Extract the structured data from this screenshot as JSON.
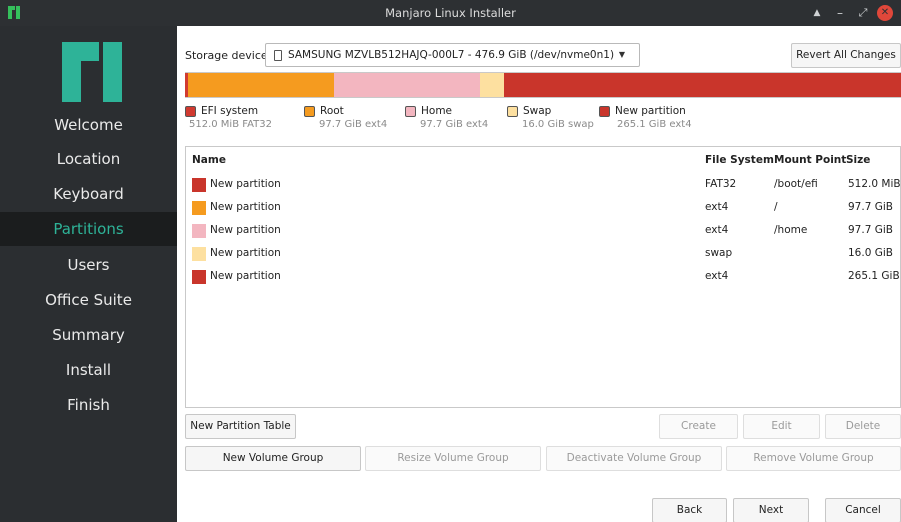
{
  "window": {
    "title": "Manjaro Linux Installer"
  },
  "sidebar": {
    "items": [
      {
        "label": "Welcome"
      },
      {
        "label": "Location"
      },
      {
        "label": "Keyboard"
      },
      {
        "label": "Partitions",
        "active": true
      },
      {
        "label": "Users"
      },
      {
        "label": "Office Suite"
      },
      {
        "label": "Summary"
      },
      {
        "label": "Install"
      },
      {
        "label": "Finish"
      }
    ]
  },
  "storage": {
    "label": "Storage device:",
    "selected": "SAMSUNG MZVLB512HAJQ-000L7 - 476.9 GiB (/dev/nvme0n1)",
    "revert_label": "Revert All Changes"
  },
  "colors": {
    "efi": "#d13a30",
    "root": "#f59b1f",
    "home": "#f3b6c0",
    "swap": "#fde0a0",
    "new": "#c9352b",
    "accent": "#2eb398"
  },
  "partition_bar": [
    {
      "name": "EFI system",
      "fraction": 0.0011,
      "color": "#d13a30"
    },
    {
      "name": "Root",
      "fraction": 0.2049,
      "color": "#f59b1f"
    },
    {
      "name": "Home",
      "fraction": 0.2049,
      "color": "#f3b6c0"
    },
    {
      "name": "Swap",
      "fraction": 0.0336,
      "color": "#fde0a0"
    },
    {
      "name": "New partition",
      "fraction": 0.5555,
      "color": "#c9352b"
    }
  ],
  "legend": [
    {
      "name": "EFI system",
      "detail": "512.0 MiB  FAT32",
      "color": "#d13a30"
    },
    {
      "name": "Root",
      "detail": "97.7 GiB  ext4",
      "color": "#f59b1f"
    },
    {
      "name": "Home",
      "detail": "97.7 GiB  ext4",
      "color": "#f3b6c0"
    },
    {
      "name": "Swap",
      "detail": "16.0 GiB  swap",
      "color": "#fde0a0"
    },
    {
      "name": "New partition",
      "detail": "265.1 GiB  ext4",
      "color": "#c9352b"
    }
  ],
  "table": {
    "headers": [
      "Name",
      "File System",
      "Mount Point",
      "Size"
    ],
    "rows": [
      {
        "name": "New partition",
        "fs": "FAT32",
        "mount": "/boot/efi",
        "size": "512.0 MiB",
        "color": "#c9352b"
      },
      {
        "name": "New partition",
        "fs": "ext4",
        "mount": "/",
        "size": "97.7 GiB",
        "color": "#f59b1f"
      },
      {
        "name": "New partition",
        "fs": "ext4",
        "mount": "/home",
        "size": "97.7 GiB",
        "color": "#f3b6c0"
      },
      {
        "name": "New partition",
        "fs": "swap",
        "mount": "",
        "size": "16.0 GiB",
        "color": "#fde0a0"
      },
      {
        "name": "New partition",
        "fs": "ext4",
        "mount": "",
        "size": "265.1 GiB",
        "color": "#c9352b"
      }
    ]
  },
  "actions": {
    "new_partition_table": "New Partition Table",
    "create": "Create",
    "edit": "Edit",
    "delete": "Delete",
    "new_volume_group": "New Volume Group",
    "resize_volume_group": "Resize Volume Group",
    "deactivate_volume_group": "Deactivate Volume Group",
    "remove_volume_group": "Remove Volume Group"
  },
  "footer": {
    "back": "Back",
    "next": "Next",
    "cancel": "Cancel"
  }
}
